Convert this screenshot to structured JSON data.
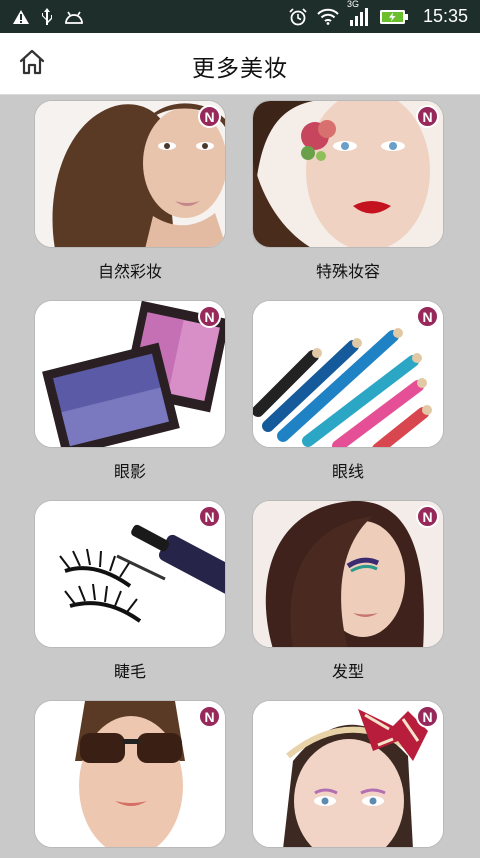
{
  "status_bar": {
    "time": "15:35",
    "network": "3G",
    "icons_left": [
      "warning-icon",
      "usb-icon",
      "android-icon"
    ],
    "icons_right": [
      "alarm-icon",
      "wifi-icon",
      "signal-icon",
      "battery-charging-icon"
    ]
  },
  "header": {
    "title": "更多美妆",
    "home_icon": "home-icon"
  },
  "categories": [
    {
      "label": "自然彩妆",
      "badge": "N"
    },
    {
      "label": "特殊妆容",
      "badge": "N"
    },
    {
      "label": "眼影",
      "badge": "N"
    },
    {
      "label": "眼线",
      "badge": "N"
    },
    {
      "label": "睫毛",
      "badge": "N"
    },
    {
      "label": "发型",
      "badge": "N"
    },
    {
      "label": "",
      "badge": "N"
    },
    {
      "label": "",
      "badge": "N"
    }
  ],
  "colors": {
    "badge": "#97285a",
    "status_bar": "#1e2e2b",
    "background": "#c9c9c9"
  }
}
